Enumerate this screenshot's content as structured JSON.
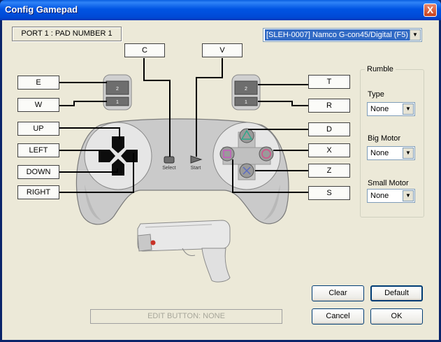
{
  "window": {
    "title": "Config Gamepad",
    "close_label": "X"
  },
  "port_label": "PORT 1 : PAD NUMBER 1",
  "device_select": {
    "value": "[SLEH-0007] Namco G-con45/Digital (F5)"
  },
  "bindings": {
    "l2": "E",
    "l1": "W",
    "up": "UP",
    "left": "LEFT",
    "down": "DOWN",
    "right": "RIGHT",
    "select": "C",
    "start": "V",
    "r2": "T",
    "r1": "R",
    "triangle": "D",
    "circle": "X",
    "cross": "Z",
    "square": "S"
  },
  "pad_text": {
    "select": "Select",
    "start": "Start",
    "l2": "2",
    "l1": "1",
    "r2": "2",
    "r1": "1"
  },
  "rumble": {
    "group_label": "Rumble",
    "type_label": "Type",
    "type_value": "None",
    "big_label": "Big Motor",
    "big_value": "None",
    "small_label": "Small Motor",
    "small_value": "None"
  },
  "edit_status": "EDIT BUTTON: NONE",
  "buttons": {
    "clear": "Clear",
    "default": "Default",
    "cancel": "Cancel",
    "ok": "OK"
  }
}
